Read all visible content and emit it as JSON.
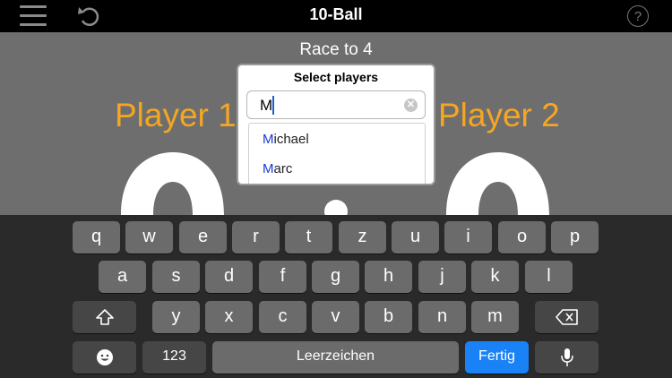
{
  "header": {
    "title": "10-Ball",
    "help_label": "?"
  },
  "match": {
    "race_label": "Race to 4",
    "player1": "Player 1",
    "player2": "Player 2"
  },
  "popup": {
    "title": "Select players",
    "search_value": "M",
    "suggestions": [
      {
        "match": "M",
        "rest": "ichael"
      },
      {
        "match": "M",
        "rest": "arc"
      }
    ]
  },
  "keyboard": {
    "row1": [
      "q",
      "w",
      "e",
      "r",
      "t",
      "z",
      "u",
      "i",
      "o",
      "p"
    ],
    "row2": [
      "a",
      "s",
      "d",
      "f",
      "g",
      "h",
      "j",
      "k",
      "l"
    ],
    "row3": [
      "y",
      "x",
      "c",
      "v",
      "b",
      "n",
      "m"
    ],
    "numbers_label": "123",
    "space_label": "Leerzeichen",
    "done_label": "Fertig"
  },
  "colors": {
    "player_accent": "#f5a623",
    "done_key": "#1a82f7",
    "match_highlight": "#1638d8"
  },
  "icons": [
    "hamburger-icon",
    "undo-icon",
    "help-icon",
    "clear-icon",
    "shift-icon",
    "backspace-icon",
    "emoji-icon",
    "microphone-icon"
  ]
}
